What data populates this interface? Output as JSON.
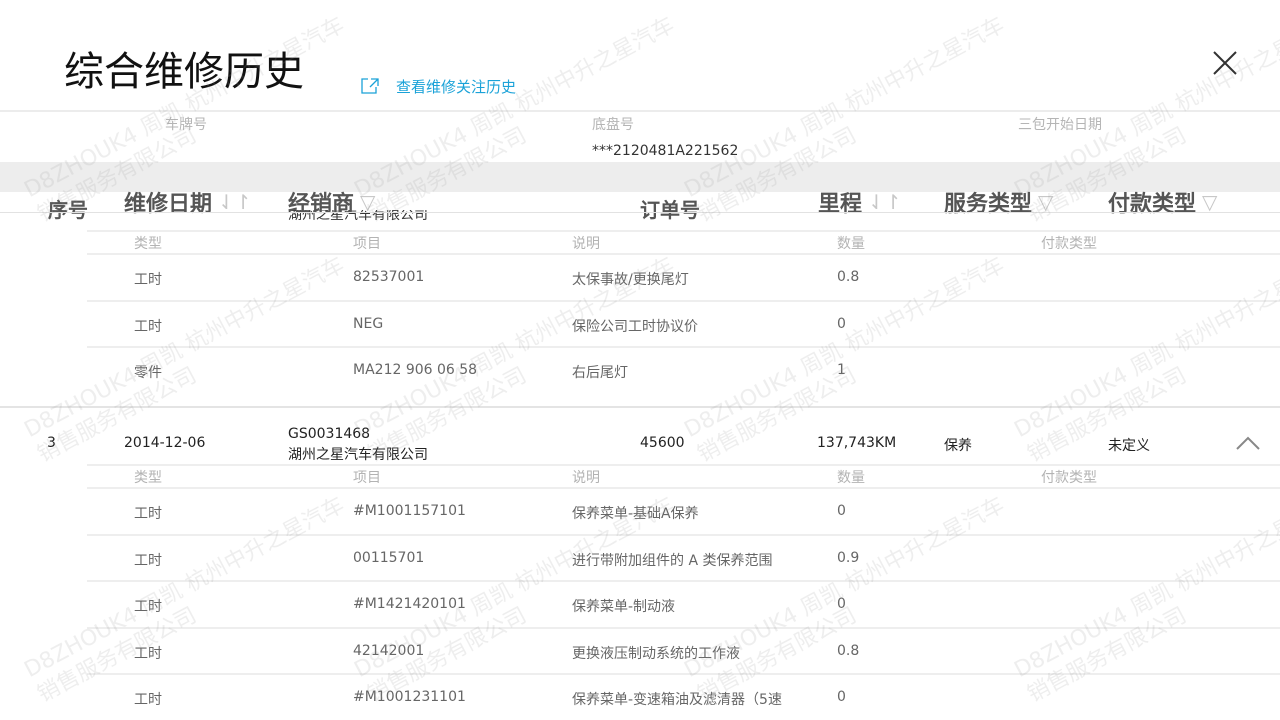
{
  "header": {
    "title": "综合维修历史",
    "link_label": "查看维修关注历史"
  },
  "vehicle_info": {
    "plate_label": "车牌号",
    "plate_value": "",
    "chassis_label": "底盘号",
    "chassis_value": "***2120481A221562",
    "warranty_label": "三包开始日期",
    "warranty_value": ""
  },
  "table": {
    "columns": {
      "index": "序号",
      "date": "维修日期",
      "dealer": "经销商",
      "order": "订单号",
      "mileage": "里程",
      "service_type": "服务类型",
      "payment_type": "付款类型"
    },
    "peek_dealer": "湖州之星汽车有限公司",
    "detail_headers": {
      "type": "类型",
      "item": "项目",
      "description": "说明",
      "quantity": "数量",
      "payment": "付款类型"
    }
  },
  "group1_details": [
    {
      "type": "工时",
      "item": "82537001",
      "description": "太保事故/更换尾灯",
      "quantity": "0.8",
      "payment": ""
    },
    {
      "type": "工时",
      "item": "NEG",
      "description": "保险公司工时协议价",
      "quantity": "0",
      "payment": ""
    },
    {
      "type": "零件",
      "item": "MA212 906 06 58",
      "description": "右后尾灯",
      "quantity": "1",
      "payment": ""
    }
  ],
  "record3": {
    "index": "3",
    "date": "2014-12-06",
    "dealer_code": "GS0031468",
    "dealer_name": "湖州之星汽车有限公司",
    "order": "45600",
    "mileage": "137,743KM",
    "service_type": "保养",
    "payment_type": "未定义"
  },
  "group3_details": [
    {
      "type": "工时",
      "item": "#M1001157101",
      "description": "保养菜单-基础A保养",
      "quantity": "0",
      "payment": ""
    },
    {
      "type": "工时",
      "item": "00115701",
      "description": "进行带附加组件的 A 类保养范围",
      "quantity": "0.9",
      "payment": ""
    },
    {
      "type": "工时",
      "item": "#M1421420101",
      "description": "保养菜单-制动液",
      "quantity": "0",
      "payment": ""
    },
    {
      "type": "工时",
      "item": "42142001",
      "description": "更换液压制动系统的工作液",
      "quantity": "0.8",
      "payment": ""
    },
    {
      "type": "工时",
      "item": "#M1001231101",
      "description": "保养菜单-变速箱油及滤清器（5速",
      "quantity": "0",
      "payment": ""
    }
  ],
  "watermark": {
    "line1": "D8ZHOUK4 周凯 杭州中升之星汽车",
    "line2": "销售服务有限公司"
  },
  "icons": {
    "external_link": "external-link-icon",
    "close": "close-icon",
    "sort": "sort-icon",
    "filter": "filter-icon",
    "collapse": "chevron-up-icon"
  },
  "colors": {
    "accent_link": "#1aa2d8",
    "header_band": "#ededed"
  }
}
